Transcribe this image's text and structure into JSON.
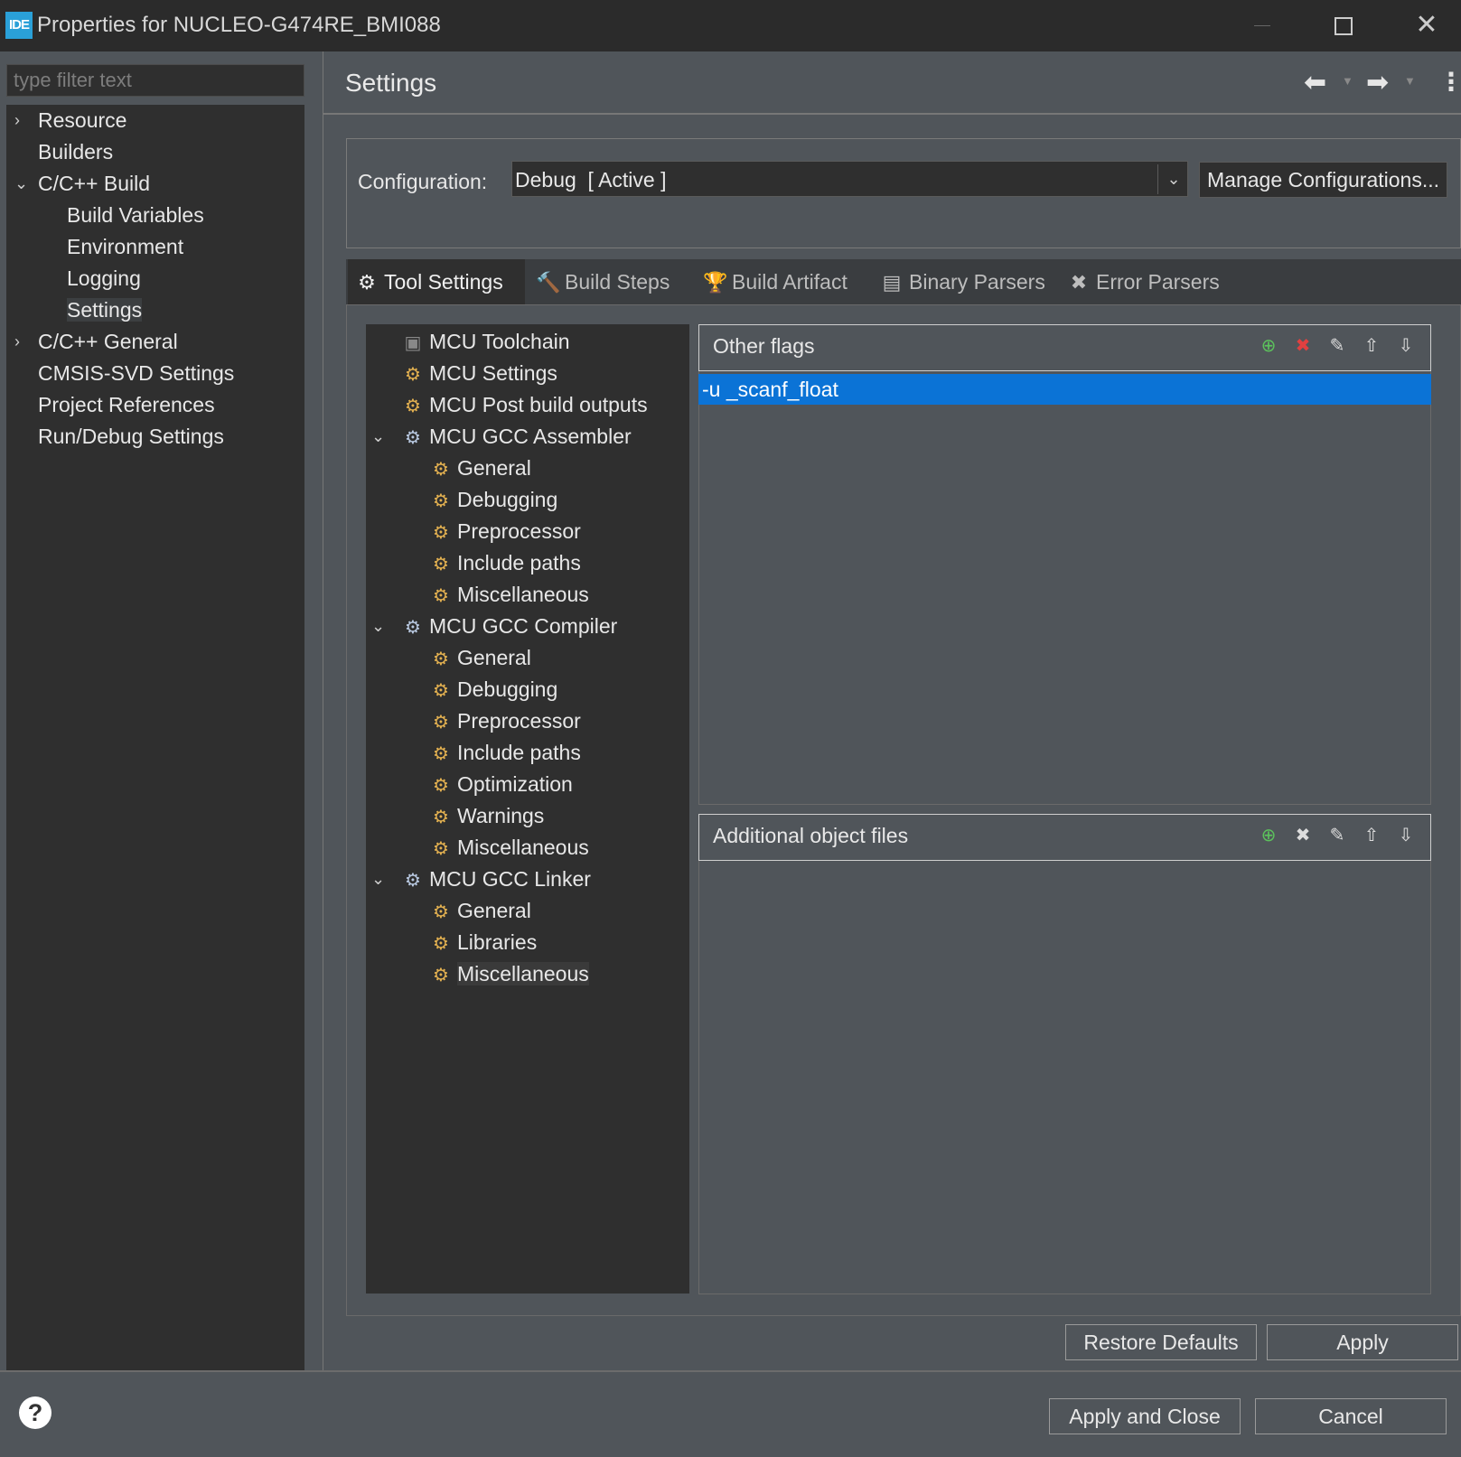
{
  "window": {
    "logo_text": "IDE",
    "title": "Properties for NUCLEO-G474RE_BMI088",
    "close_glyph": "✕"
  },
  "filter": {
    "placeholder": "type filter text"
  },
  "nav": {
    "items": [
      {
        "label": "Resource",
        "expander": "›"
      },
      {
        "label": "Builders"
      },
      {
        "label": "C/C++ Build",
        "expander": "⌄"
      },
      {
        "label": "Build Variables"
      },
      {
        "label": "Environment"
      },
      {
        "label": "Logging"
      },
      {
        "label": "Settings",
        "selected": true
      },
      {
        "label": "C/C++ General",
        "expander": "›"
      },
      {
        "label": "CMSIS-SVD Settings"
      },
      {
        "label": "Project References"
      },
      {
        "label": "Run/Debug Settings"
      }
    ]
  },
  "header": {
    "title": "Settings",
    "back_glyph": "⬅",
    "forward_glyph": "➡",
    "dropdown_glyph": "▼",
    "menu_glyph": "⋮"
  },
  "configuration": {
    "label": "Configuration:",
    "value": "Debug  [ Active ]",
    "dropdown_glyph": "⌄",
    "manage_button": "Manage Configurations..."
  },
  "tabs": [
    {
      "label": "Tool Settings",
      "icon": "gear-icon",
      "glyph": "⚙",
      "active": true
    },
    {
      "label": "Build Steps",
      "icon": "hammer-icon",
      "glyph": "🔨"
    },
    {
      "label": "Build Artifact",
      "icon": "trophy-icon",
      "glyph": "🏆"
    },
    {
      "label": "Binary Parsers",
      "icon": "binary-file-icon",
      "glyph": "▤"
    },
    {
      "label": "Error Parsers",
      "icon": "error-icon",
      "glyph": "✖"
    }
  ],
  "tool_tree": {
    "items": [
      {
        "label": "MCU Toolchain",
        "icon": "chip-icon",
        "glyph": "▣"
      },
      {
        "label": "MCU Settings",
        "icon": "settings-folder-icon",
        "glyph": "⚙"
      },
      {
        "label": "MCU Post build outputs",
        "icon": "settings-folder-icon",
        "glyph": "⚙"
      },
      {
        "label": "MCU GCC Assembler",
        "icon": "tool-gear-icon",
        "glyph": "⚙",
        "expander": "⌄"
      },
      {
        "label": "General",
        "icon": "settings-folder-icon",
        "glyph": "⚙"
      },
      {
        "label": "Debugging",
        "icon": "settings-folder-icon",
        "glyph": "⚙"
      },
      {
        "label": "Preprocessor",
        "icon": "settings-folder-icon",
        "glyph": "⚙"
      },
      {
        "label": "Include paths",
        "icon": "settings-folder-icon",
        "glyph": "⚙"
      },
      {
        "label": "Miscellaneous",
        "icon": "settings-folder-icon",
        "glyph": "⚙"
      },
      {
        "label": "MCU GCC Compiler",
        "icon": "tool-gear-icon",
        "glyph": "⚙",
        "expander": "⌄"
      },
      {
        "label": "General",
        "icon": "settings-folder-icon",
        "glyph": "⚙"
      },
      {
        "label": "Debugging",
        "icon": "settings-folder-icon",
        "glyph": "⚙"
      },
      {
        "label": "Preprocessor",
        "icon": "settings-folder-icon",
        "glyph": "⚙"
      },
      {
        "label": "Include paths",
        "icon": "settings-folder-icon",
        "glyph": "⚙"
      },
      {
        "label": "Optimization",
        "icon": "settings-folder-icon",
        "glyph": "⚙"
      },
      {
        "label": "Warnings",
        "icon": "settings-folder-icon",
        "glyph": "⚙"
      },
      {
        "label": "Miscellaneous",
        "icon": "settings-folder-icon",
        "glyph": "⚙"
      },
      {
        "label": "MCU GCC Linker",
        "icon": "tool-gear-icon",
        "glyph": "⚙",
        "expander": "⌄"
      },
      {
        "label": "General",
        "icon": "settings-folder-icon",
        "glyph": "⚙"
      },
      {
        "label": "Libraries",
        "icon": "settings-folder-icon",
        "glyph": "⚙"
      },
      {
        "label": "Miscellaneous",
        "icon": "settings-folder-icon",
        "glyph": "⚙",
        "selected": true
      }
    ]
  },
  "other_flags": {
    "title": "Other flags",
    "values": [
      "-u _scanf_float"
    ]
  },
  "additional_objects": {
    "title": "Additional object files",
    "values": []
  },
  "list_tools": [
    {
      "name": "add-icon",
      "glyph": "⊕"
    },
    {
      "name": "delete-icon",
      "glyph": "✖"
    },
    {
      "name": "edit-icon",
      "glyph": "✎"
    },
    {
      "name": "move-up-icon",
      "glyph": "⇧"
    },
    {
      "name": "move-down-icon",
      "glyph": "⇩"
    }
  ],
  "buttons": {
    "restore_defaults": "Restore Defaults",
    "apply": "Apply",
    "apply_and_close": "Apply and Close",
    "cancel": "Cancel",
    "help": "?"
  },
  "colors": {
    "selection": "#0b73d6",
    "background": "#50555a",
    "panel": "#2f2f2f"
  }
}
